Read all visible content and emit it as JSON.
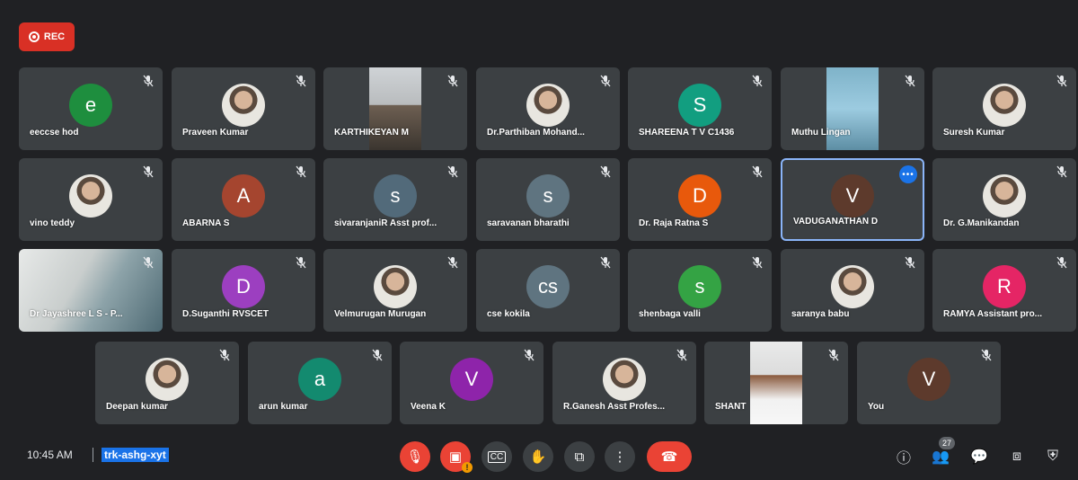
{
  "recording": {
    "label": "REC"
  },
  "participants": [
    {
      "name": "eeccse hod",
      "initial": "e",
      "color": "#1e8e3e",
      "kind": "avatar"
    },
    {
      "name": "Praveen Kumar",
      "kind": "photo"
    },
    {
      "name": "KARTHIKEYAN M",
      "kind": "video"
    },
    {
      "name": "Dr.Parthiban Mohand...",
      "kind": "photo"
    },
    {
      "name": "SHAREENA T V C1436",
      "initial": "S",
      "color": "#129e80",
      "kind": "avatar"
    },
    {
      "name": "Muthu Lingan",
      "kind": "video2"
    },
    {
      "name": "Suresh Kumar",
      "kind": "photo"
    },
    {
      "name": "vino teddy",
      "kind": "photo"
    },
    {
      "name": "ABARNA S",
      "initial": "A",
      "color": "#a5452f",
      "kind": "avatar"
    },
    {
      "name": "sivaranjaniR Asst prof...",
      "initial": "s",
      "color": "#526a7a",
      "kind": "avatar"
    },
    {
      "name": "saravanan bharathi",
      "initial": "s",
      "color": "#5f7480",
      "kind": "avatar"
    },
    {
      "name": "Dr. Raja Ratna S",
      "initial": "D",
      "color": "#e8590c",
      "kind": "avatar"
    },
    {
      "name": "VADUGANATHAN D",
      "initial": "V",
      "color": "#5d3a2c",
      "kind": "avatar"
    },
    {
      "name": "Dr. G.Manikandan",
      "kind": "photo"
    },
    {
      "name": "Dr Jayashree L S - P...",
      "kind": "bigvideo"
    },
    {
      "name": "D.Suganthi RVSCET",
      "initial": "D",
      "color": "#9c3fc0",
      "kind": "avatar"
    },
    {
      "name": "Velmurugan Murugan",
      "kind": "photo"
    },
    {
      "name": "cse kokila",
      "initial": "cs",
      "color": "#5f7480",
      "kind": "avatar"
    },
    {
      "name": "shenbaga valli",
      "initial": "s",
      "color": "#34a344",
      "kind": "avatar"
    },
    {
      "name": "saranya babu",
      "kind": "photo"
    },
    {
      "name": "RAMYA Assistant pro...",
      "initial": "R",
      "color": "#e52565",
      "kind": "avatar"
    },
    {
      "name": "Deepan kumar",
      "kind": "photo"
    },
    {
      "name": "arun kumar",
      "initial": "a",
      "color": "#138a6f",
      "kind": "avatar"
    },
    {
      "name": "Veena K",
      "initial": "V",
      "color": "#8e24aa",
      "kind": "avatar"
    },
    {
      "name": "R.Ganesh Asst Profes...",
      "kind": "photo"
    },
    {
      "name": "SHANT",
      "kind": "video3"
    },
    {
      "name": "You",
      "initial": "V",
      "color": "#5d3a2c",
      "kind": "avatar"
    }
  ],
  "bottombar": {
    "time": "10:45 AM",
    "meeting_code": "trk-ashg-xyt",
    "participant_count": "27",
    "warning_badge": "!"
  },
  "colors": {
    "background": "#202124",
    "tile": "#3c4043",
    "accent": "#1a73e8",
    "danger": "#ea4335"
  }
}
